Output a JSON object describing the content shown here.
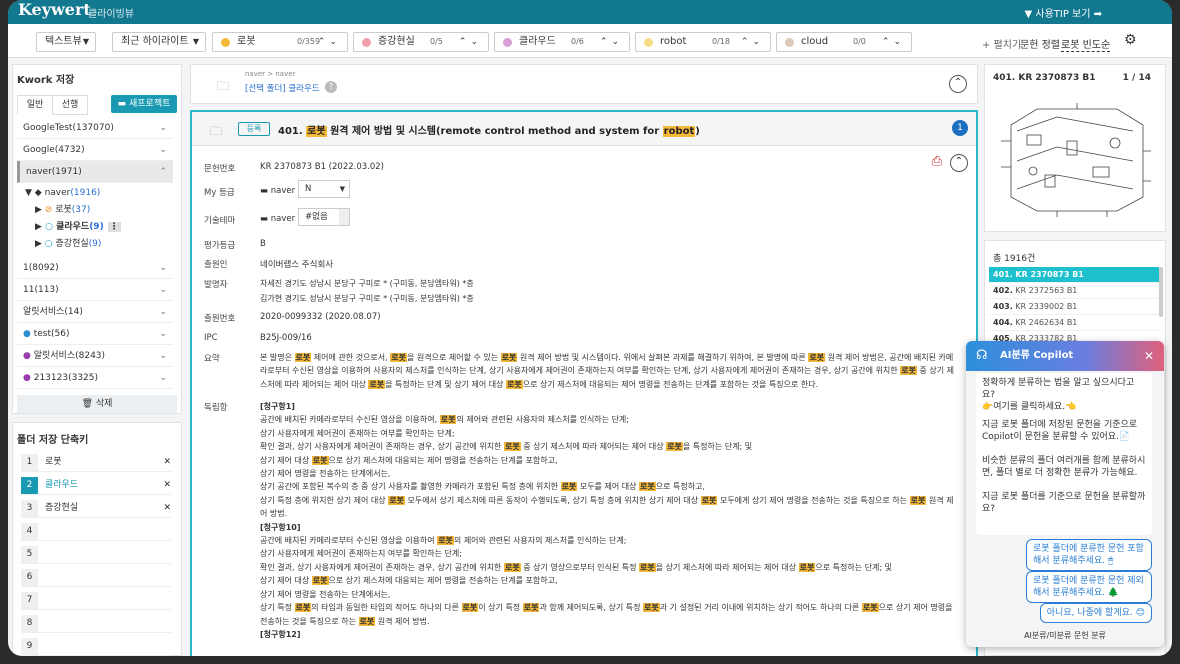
{
  "app": {
    "logo": "Keywert",
    "subtitle": "클라이빙뷰",
    "tip": "▼ 사용TIP 보기 ➡"
  },
  "toolbar": {
    "text_view": "텍스트뷰",
    "recent_highlight": "최근 하이라이트",
    "keywords": [
      {
        "label": "로봇",
        "count": "0/359",
        "color": "#f5b93a"
      },
      {
        "label": "증강현실",
        "count": "0/5",
        "color": "#f0a0a8"
      },
      {
        "label": "클라우드",
        "count": "0/6",
        "color": "#d8a0d8"
      },
      {
        "label": "robot",
        "count": "0/18",
        "color": "#f7dc86"
      },
      {
        "label": "cloud",
        "count": "0/0",
        "color": "#dcc8b8"
      }
    ],
    "expand": "+ 펼치기",
    "sort_prefix": "문헌 정렬",
    "sort_value": "로봇 빈도순"
  },
  "sidebar": {
    "title": "Kwork 저장",
    "tabs": [
      "일반",
      "선행"
    ],
    "new_project": "새프로젝트",
    "folders": [
      "GoogleTest(137070)",
      "Google(4732)",
      "naver(1971)"
    ],
    "naver_tree": {
      "root": "naver",
      "root_count": "(1916)",
      "children": [
        {
          "label": "로봇",
          "count": "(37)"
        },
        {
          "label": "클라우드",
          "count": "(9)"
        },
        {
          "label": "증강현실",
          "count": "(9)"
        }
      ]
    },
    "folders2": [
      "1(8092)",
      "11(113)",
      "알릿서비스(14)",
      "test(56)",
      "알릿서비스(8243)",
      "213123(3325)"
    ],
    "delete": "삭제"
  },
  "shortcuts": {
    "title": "폴더 저장 단축키",
    "items": [
      {
        "n": "1",
        "label": "로봇"
      },
      {
        "n": "2",
        "label": "클라우드"
      },
      {
        "n": "3",
        "label": "증강현실"
      },
      {
        "n": "4",
        "label": ""
      },
      {
        "n": "5",
        "label": ""
      },
      {
        "n": "6",
        "label": ""
      },
      {
        "n": "7",
        "label": ""
      },
      {
        "n": "8",
        "label": ""
      },
      {
        "n": "9",
        "label": ""
      }
    ]
  },
  "folder_path": {
    "crumb": "naver > naver",
    "selected": "[선택 폴더] 클라우드"
  },
  "doc": {
    "badge": "등록",
    "number": "401.",
    "title_pre": "원격 제어 방법 및 시스템(remote control method and system for",
    "title_kw1": "로봇",
    "title_kw2": "robot",
    "circle": "1",
    "fields": [
      {
        "k": "문헌번호",
        "v": "KR 2370873 B1 (2022.03.02)"
      },
      {
        "k": "My 등급",
        "v": "naver"
      },
      {
        "k": "기술테마",
        "v": "naver"
      },
      {
        "k": "평가등급",
        "v": "B"
      },
      {
        "k": "출원인",
        "v": "네이버랩스 주식회사"
      },
      {
        "k": "발명자",
        "v": "차세진  경기도 성남시 분당구 구미로 * (구미동, 분당엠타워) *층"
      },
      {
        "k": "",
        "v": "김가현  경기도 성남시 분당구 구미로 * (구미동, 분당엠타워) *층"
      },
      {
        "k": "출원번호",
        "v": "2020-0099332 (2020.08.07)"
      },
      {
        "k": "IPC",
        "v": "B25J-009/16"
      },
      {
        "k": "요약",
        "v": ""
      },
      {
        "k": "독립항",
        "v": ""
      }
    ],
    "grade_value": "N",
    "theme_value": "#없음",
    "summary": "본 발명은 로봇 제어에 관한 것으로서, 로봇을 원격으로 제어할 수 있는 로봇 원격 제어 방법 및 시스템이다. 위에서 살펴본 과제를 해결하기 위하여, 본 발명에 따른 로봇 원격 제어 방법은, 공간에 배치된 카메라로부터 수신된 영상을 이용하여 사용자의 제스처를 인식하는 단계, 상기 사용자에게 제어권이 존재하는지 여부를 확인하는 단계, 상기 사용자에게 제어권이 존재하는 경우, 상기 공간에 위치한 로봇 중 상기 제스처에 따라 제어되는 제어 대상 로봇을 특정하는 단계 및 상기 제어 대상 로봇으로 상기 제스처에 대응되는 제어 명령을 전송하는 단계를 포함하는 것을 특징으로 한다.",
    "claims": [
      "[청구항1]",
      "공간에 배치된 카메라로부터 수신된 영상을 이용하여, 로봇의 제어와 관련된 사용자의 제스처를 인식하는 단계;",
      "상기 사용자에게 제어권이 존재하는 여부를 확인하는 단계;",
      "확인 결과, 상기 사용자에게 제어권이 존재하는 경우, 상기 공간에 위치한 로봇 중 상기 제스처에 따라 제어되는 제어 대상 로봇을 특정하는 단계; 및",
      "상기 제어 대상 로봇으로 상기 제스처에 대응되는 제어 명령을 전송하는 단계를 포함하고,",
      "상기 제어 명령을 전송하는 단계에서는,",
      "상기 공간에 포함된 복수의 층 중 상기 사용자를 촬영한 카메라가 포함된 특정 층에 위치한 로봇 모두를 제어 대상 로봇으로 특정하고,",
      "상기 특정 층에 위치한 상기 제어 대상 로봇 모두에서 상기 제스처에 따른 동작이 수행되도록, 상기 특정 층에 위치한 상기 제어 대상 로봇 모두에게 상기 제어 명령을 전송하는 것을 특징으로 하는 로봇 원격 제어 방법.",
      "[청구항10]",
      "공간에 배치된 카메라로부터 수신된 영상을 이용하여 로봇의 제어와 관련된 사용자의 제스처를 인식하는 단계;",
      "상기 사용자에게 제어권이 존재하는지 여부를 확인하는 단계;",
      "확인 결과, 상기 사용자에게 제어권이 존재하는 경우, 상기 공간에 위치한 로봇 중 상기 영상으로부터 인식된 특정 로봇을 상기 제스처에 따라 제어되는 제어 대상 로봇으로 특정하는 단계; 및",
      "상기 제어 대상 로봇으로 상기 제스처에 대응되는 제어 명령을 전송하는 단계를 포함하고,",
      "상기 제어 명령을 전송하는 단계에서는,",
      "상기 특정 로봇의 타입과 동일한 타입의 적어도 하나의 다른 로봇이 상기 특정 로봇과 함께 제어되도록, 상기 특정 로봇과 기 설정된 거리 이내에 위치하는 상기 적어도 하나의 다른 로봇으로 상기 제어 명령을 전송하는 것을 특징으로 하는 로봇 원격 제어 방법.",
      "[청구항12]"
    ]
  },
  "right": {
    "header": "401. KR 2370873 B1",
    "pager": "1 / 14",
    "total": "총 1916건",
    "list": [
      {
        "n": "401.",
        "id": "KR 2370873 B1"
      },
      {
        "n": "402.",
        "id": "KR 2372563 B1"
      },
      {
        "n": "403.",
        "id": "KR 2339002 B1"
      },
      {
        "n": "404.",
        "id": "KR 2462634 B1"
      },
      {
        "n": "405.",
        "id": "KR 2333782 B1"
      }
    ]
  },
  "copilot": {
    "title": "AI분류 Copilot",
    "msg1": "정확하게 분류하는 법을 알고 싶으시다고요?\n👉여기를 클릭하세요.👈",
    "msg2": "지금 로봇 폴더에 저장된 문헌을 기준으로 Copilot이 문헌을 분류할 수 있어요.📄\n\n비슷한 분류의 폴더 여러개를 함께 분류하시면, 폴더 별로 더 정확한 분류가 가능해요.\n\n지금 로봇 폴더를 기준으로 문헌을 분류할까요?",
    "btn1": "로봇 폴더에 분류한 문헌 포함해서 분류해주세요. 🖱",
    "btn2": "로봇 폴더에 분류한 문헌 제외해서 분류해주세요. 🌲",
    "btn3": "아니요, 나중에 할게요. 😊",
    "footer": "AI분류/미분류 문헌 분류"
  }
}
